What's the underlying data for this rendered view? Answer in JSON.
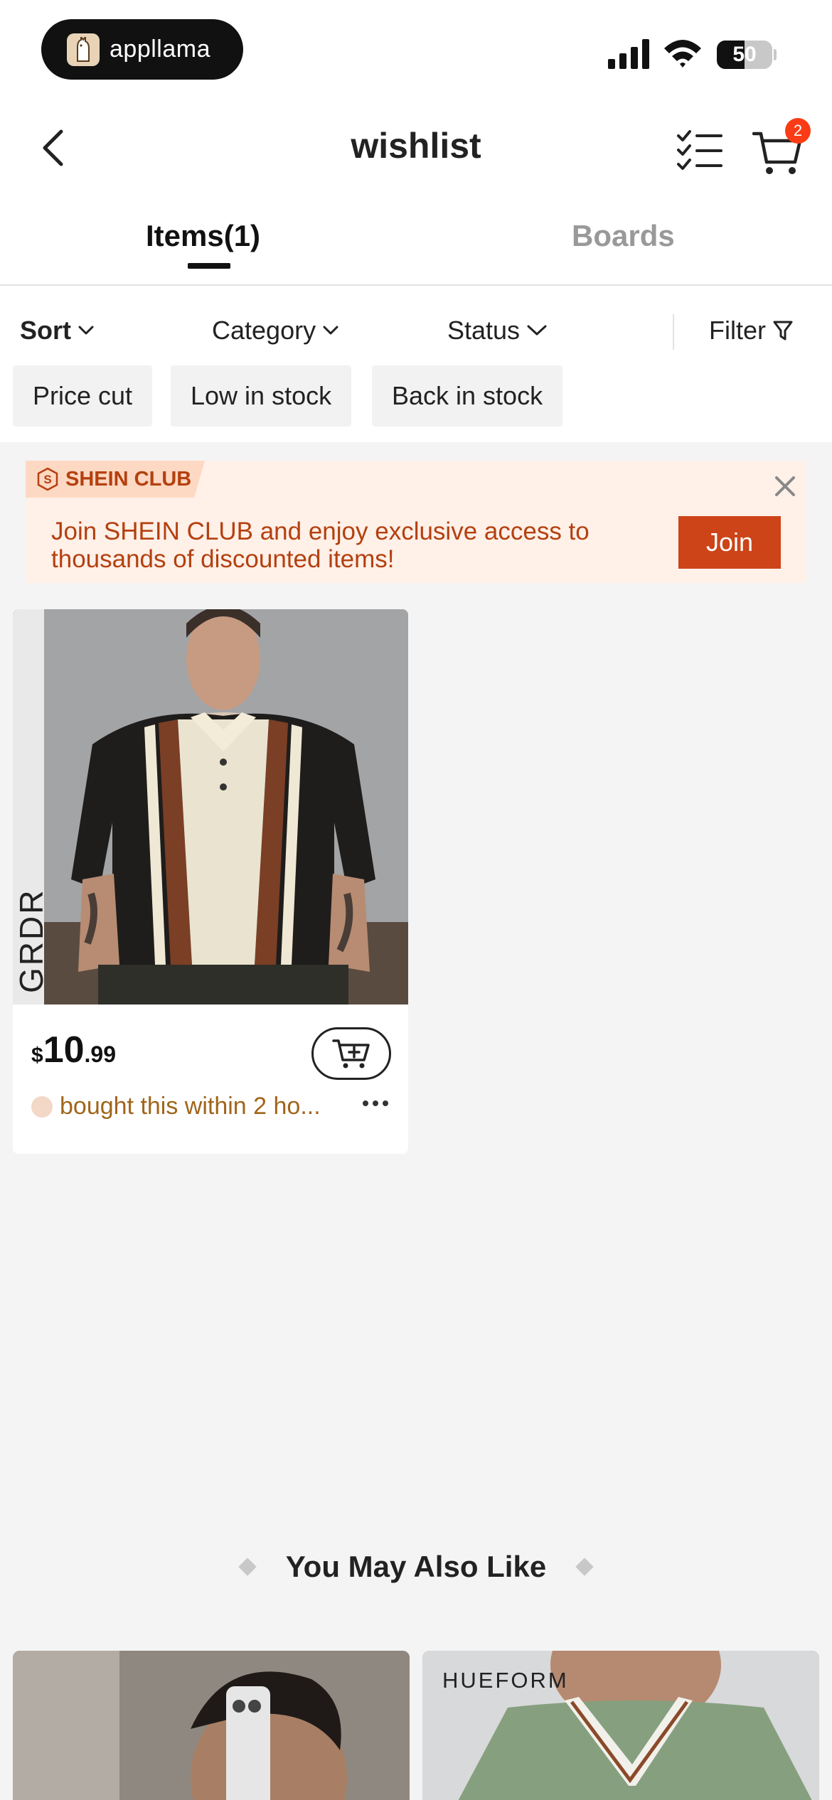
{
  "status_bar": {
    "app_pill_label": "appllama",
    "battery": "50",
    "battery_level": 0.5
  },
  "header": {
    "title": "wishlist",
    "cart_count": "2"
  },
  "tabs": [
    {
      "label": "Items(1)",
      "active": true
    },
    {
      "label": "Boards",
      "active": false
    }
  ],
  "filters": {
    "sort": "Sort",
    "category": "Category",
    "status": "Status",
    "filter": "Filter",
    "chips": [
      "Price cut",
      "Low in stock",
      "Back in stock"
    ]
  },
  "club_banner": {
    "tag": "SHEIN CLUB",
    "message": "Join SHEIN CLUB and enjoy exclusive access to thousands of discounted items!",
    "join_label": "Join"
  },
  "items": [
    {
      "brand": "GRDR",
      "price_currency": "$",
      "price_int": "10",
      "price_dec": ".99",
      "social_proof": "bought this within 2 ho..."
    }
  ],
  "recommendations": {
    "title": "You May Also Like",
    "cards": [
      {
        "brand": ""
      },
      {
        "brand": "HUEFORM"
      }
    ]
  },
  "colors": {
    "accent": "#cc4418",
    "club_bg": "#fff0e8",
    "club_text": "#b4400f",
    "badge": "#fa3c16",
    "social_text": "#a0651b"
  }
}
